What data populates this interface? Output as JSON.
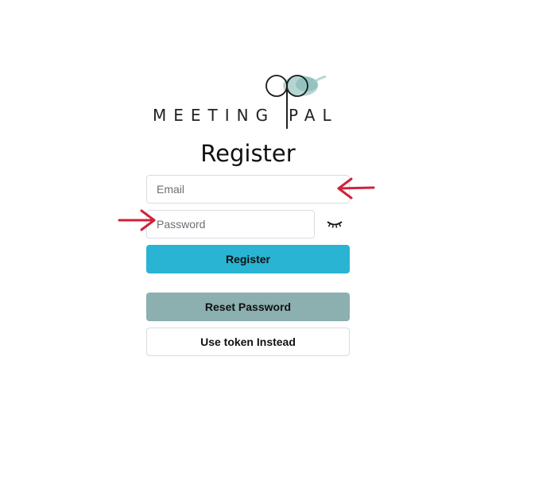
{
  "brand": {
    "word_left": "MEETING",
    "word_right": "PAL"
  },
  "form": {
    "title": "Register",
    "email_placeholder": "Email",
    "password_placeholder": "Password",
    "register_label": "Register",
    "reset_label": "Reset Password",
    "token_label": "Use token Instead"
  },
  "colors": {
    "register_button": "#29b4d3",
    "reset_button": "#8cb0b0",
    "annotation_arrow": "#d0223a"
  },
  "icons": {
    "password_toggle": "eye-closed-icon",
    "annotation": "arrow-icon"
  }
}
